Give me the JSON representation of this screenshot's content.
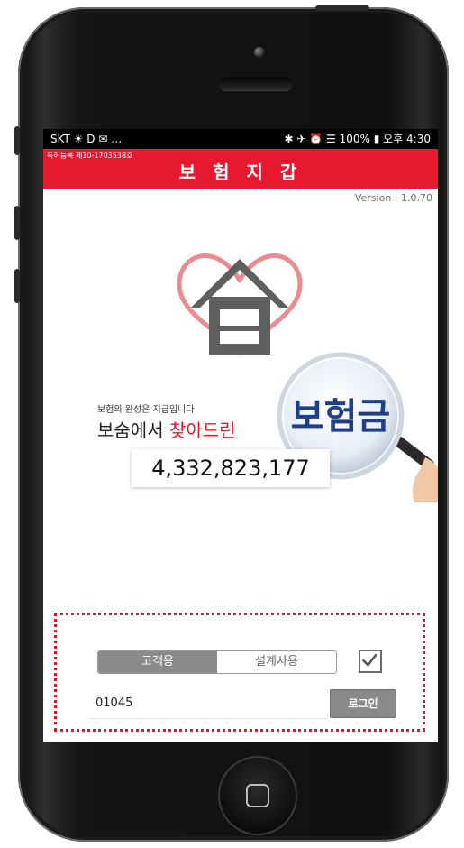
{
  "status_bar": {
    "left": "SKT ☀ D ✉ …",
    "right": "✱ ✈ ⏰ ☰ 100% ▮ 오후 4:30"
  },
  "app_bar": {
    "patent": "특허등록 제10-1703538호",
    "title": "보 험 지 갑"
  },
  "version": "Version : 1.0.70",
  "hero": {
    "tagline_small": "보험의 완성은 지급입니다",
    "tagline_prefix": "보숨에서 ",
    "tagline_highlight": "찾아드린",
    "magnifier_word": "보험금",
    "amount": "4,332,823,177"
  },
  "login": {
    "tabs": [
      "고객용",
      "설계사용"
    ],
    "selected_tab": "고객용",
    "remember_checked": true,
    "id_value": "01045",
    "login_label": "로그인"
  },
  "colors": {
    "brand_red": "#e7192f",
    "dotted_frame": "#d81b2a",
    "button_gray": "#8a8a8a"
  },
  "icons": [
    "logo-house-heart-icon",
    "magnifier-icon",
    "checkbox-check-icon",
    "home-button-icon"
  ]
}
